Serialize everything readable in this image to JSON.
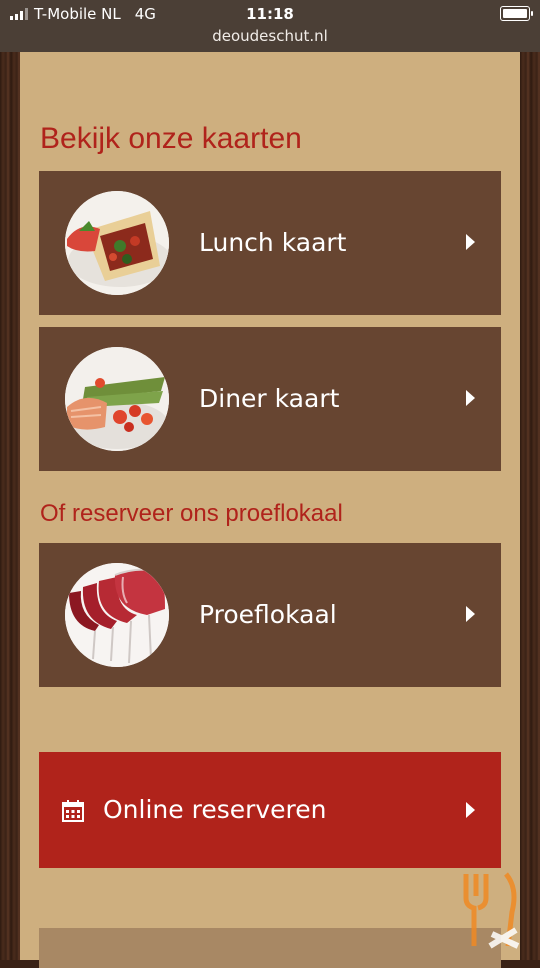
{
  "status_bar": {
    "carrier": "T-Mobile NL",
    "network": "4G",
    "time": "11:18",
    "url": "deoudeschut.nl"
  },
  "main": {
    "heading_menus": "Bekijk onze kaarten",
    "heading_reserve": "Of reserveer ons proeflokaal",
    "cards": [
      {
        "label": "Lunch kaart",
        "icon": "wrap-food-image"
      },
      {
        "label": "Diner kaart",
        "icon": "salmon-dish-image"
      },
      {
        "label": "Proeflokaal",
        "icon": "wine-glasses-image"
      }
    ],
    "reserve_button": {
      "label": "Online reserveren",
      "icon": "calendar-icon"
    }
  },
  "colors": {
    "page_background": "#ceaf7f",
    "card": "#674531",
    "accent_red": "#b0231b"
  }
}
